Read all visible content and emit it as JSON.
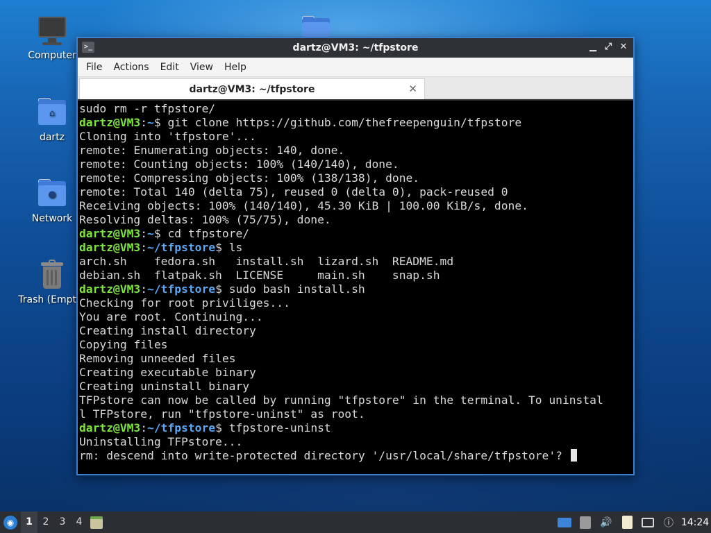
{
  "desktop": {
    "icons": [
      {
        "label": "Computer"
      },
      {
        "label": "dartz"
      },
      {
        "label": "Network"
      },
      {
        "label": "Trash (Empty)"
      }
    ]
  },
  "window": {
    "title": "dartz@VM3: ~/tfpstore",
    "controls": {
      "minimize": "▁",
      "maximize": "⤢",
      "close": "✕"
    },
    "menu": [
      "File",
      "Actions",
      "Edit",
      "View",
      "Help"
    ],
    "tab": {
      "label": "dartz@VM3: ~/tfpstore",
      "close": "✕"
    }
  },
  "terminal": {
    "lines": [
      {
        "text": "sudo rm -r tfpstore/"
      },
      {
        "user": "dartz@VM3",
        "sep": ":",
        "path": "~",
        "prompt": "$ ",
        "cmd": "git clone https://github.com/thefreepenguin/tfpstore"
      },
      {
        "text": "Cloning into 'tfpstore'..."
      },
      {
        "text": "remote: Enumerating objects: 140, done."
      },
      {
        "text": "remote: Counting objects: 100% (140/140), done."
      },
      {
        "text": "remote: Compressing objects: 100% (138/138), done."
      },
      {
        "text": "remote: Total 140 (delta 75), reused 0 (delta 0), pack-reused 0"
      },
      {
        "text": "Receiving objects: 100% (140/140), 45.30 KiB | 100.00 KiB/s, done."
      },
      {
        "text": "Resolving deltas: 100% (75/75), done."
      },
      {
        "user": "dartz@VM3",
        "sep": ":",
        "path": "~",
        "prompt": "$ ",
        "cmd": "cd tfpstore/"
      },
      {
        "user": "dartz@VM3",
        "sep": ":",
        "path": "~/tfpstore",
        "prompt": "$ ",
        "cmd": "ls"
      },
      {
        "text": "arch.sh    fedora.sh   install.sh  lizard.sh  README.md"
      },
      {
        "text": "debian.sh  flatpak.sh  LICENSE     main.sh    snap.sh"
      },
      {
        "user": "dartz@VM3",
        "sep": ":",
        "path": "~/tfpstore",
        "prompt": "$ ",
        "cmd": "sudo bash install.sh"
      },
      {
        "text": "Checking for root priviliges..."
      },
      {
        "text": "You are root. Continuing..."
      },
      {
        "text": "Creating install directory"
      },
      {
        "text": "Copying files"
      },
      {
        "text": "Removing unneeded files"
      },
      {
        "text": "Creating executable binary"
      },
      {
        "text": "Creating uninstall binary"
      },
      {
        "text": "TFPstore can now be called by running \"tfpstore\" in the terminal. To uninstal"
      },
      {
        "text": "l TFPstore, run \"tfpstore-uninst\" as root."
      },
      {
        "user": "dartz@VM3",
        "sep": ":",
        "path": "~/tfpstore",
        "prompt": "$ ",
        "cmd": "tfpstore-uninst"
      },
      {
        "text": "Uninstalling TFPstore..."
      },
      {
        "text": "rm: descend into write-protected directory '/usr/local/share/tfpstore'? ",
        "cursor": true
      }
    ]
  },
  "taskbar": {
    "workspaces": [
      "1",
      "2",
      "3",
      "4"
    ],
    "clock": "14:24"
  },
  "colors": {
    "prompt_user": "#7de33e",
    "prompt_path": "#5aa6f0",
    "window_border": "#3b7fd0"
  }
}
